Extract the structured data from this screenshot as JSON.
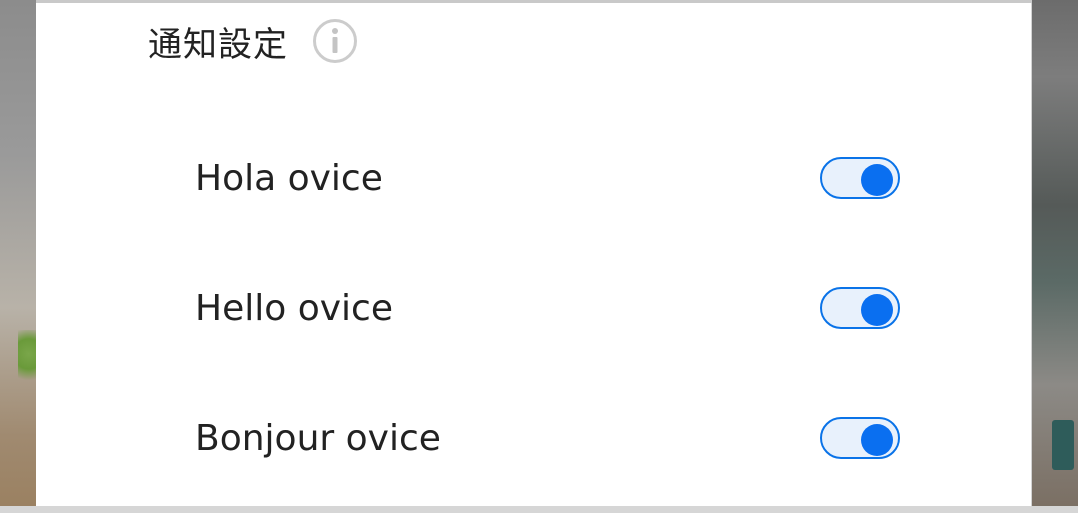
{
  "dialog": {
    "title": "通知設定",
    "info_icon": "info-icon"
  },
  "settings": [
    {
      "label": "Hola ovice",
      "enabled": true
    },
    {
      "label": "Hello ovice",
      "enabled": true
    },
    {
      "label": "Bonjour ovice",
      "enabled": true
    }
  ],
  "colors": {
    "accent": "#0a6ff0",
    "toggle_track": "#e8f1fc",
    "text": "#222222",
    "icon_gray": "#cccccc"
  }
}
